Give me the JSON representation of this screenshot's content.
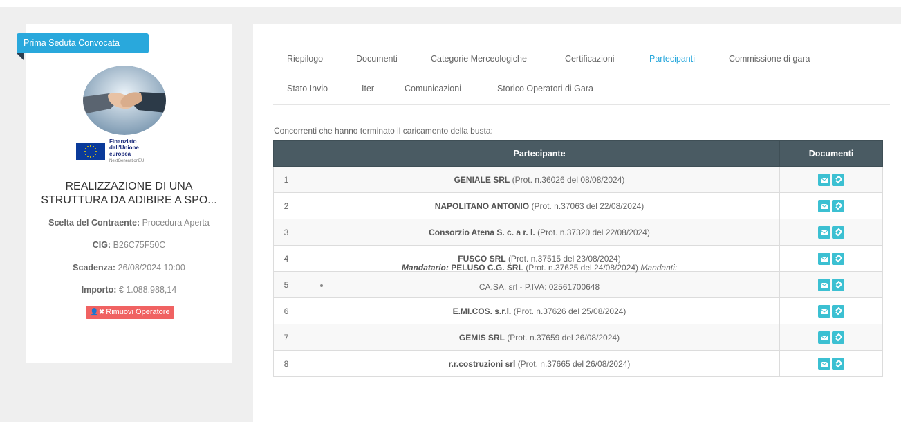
{
  "sidebar": {
    "status_badge": "Prima Seduta Convocata",
    "eu_logo": {
      "line1": "Finanziato",
      "line2": "dall'Unione europea",
      "line3": "NextGenerationEU"
    },
    "title_line1": "REALIZZAZIONE DI UNA",
    "title_line2": "STRUTTURA DA ADIBIRE A SPO...",
    "scelta_label": "Scelta del Contraente:",
    "scelta_value": "Procedura Aperta",
    "cig_label": "CIG:",
    "cig_value": "B26C75F50C",
    "scadenza_label": "Scadenza:",
    "scadenza_value": "26/08/2024 10:00",
    "importo_label": "Importo:",
    "importo_value": "€ 1.088.988,14",
    "remove_button": "Rimuovi Operatore"
  },
  "tabs": [
    {
      "label": "Riepilogo"
    },
    {
      "label": "Documenti"
    },
    {
      "label": "Categorie Merceologiche"
    },
    {
      "label": "Certificazioni"
    },
    {
      "label": "Partecipanti"
    },
    {
      "label": "Commissione di gara"
    },
    {
      "label": "Stato Invio"
    },
    {
      "label": "Iter"
    },
    {
      "label": "Comunicazioni"
    },
    {
      "label": "Storico Operatori di Gara"
    }
  ],
  "caption": "Concorrenti che hanno terminato il caricamento della busta:",
  "table": {
    "headers": [
      "",
      "Partecipante",
      "Documenti"
    ],
    "rows": [
      {
        "num": "1",
        "name": "GENIALE SRL",
        "prot": "(Prot. n.36026 del 08/08/2024)"
      },
      {
        "num": "2",
        "name": "NAPOLITANO ANTONIO",
        "prot": "(Prot. n.37063 del 22/08/2024)"
      },
      {
        "num": "3",
        "name": "Consorzio Atena S. c. a r. l.",
        "prot": "(Prot. n.37320 del 22/08/2024)"
      },
      {
        "num": "4",
        "name": "FUSCO SRL",
        "prot": "(Prot. n.37515 del 23/08/2024)"
      },
      {
        "num": "5",
        "mandatario_label": "Mandatario:",
        "name": "PELUSO C.G. SRL",
        "prot": "(Prot. n.37625 del 24/08/2024)",
        "mandanti_label": "Mandanti:",
        "mandanti": [
          "CA.SA. srl - P.IVA: 02561700648"
        ]
      },
      {
        "num": "6",
        "name": "E.MI.COS. s.r.l.",
        "prot": "(Prot. n.37626 del 25/08/2024)"
      },
      {
        "num": "7",
        "name": "GEMIS SRL",
        "prot": "(Prot. n.37659 del 26/08/2024)"
      },
      {
        "num": "8",
        "name": "r.r.costruzioni srl",
        "prot": "(Prot. n.37665 del 26/08/2024)"
      }
    ]
  },
  "colors": {
    "accent": "#29a8dc",
    "header": "#4a5b63",
    "doc_button": "#3cc0d2",
    "danger": "#f06262"
  },
  "icons": {
    "doc_buttons": [
      "envelope-icon",
      "paperclip-icon"
    ],
    "remove": "user-times-icon"
  }
}
